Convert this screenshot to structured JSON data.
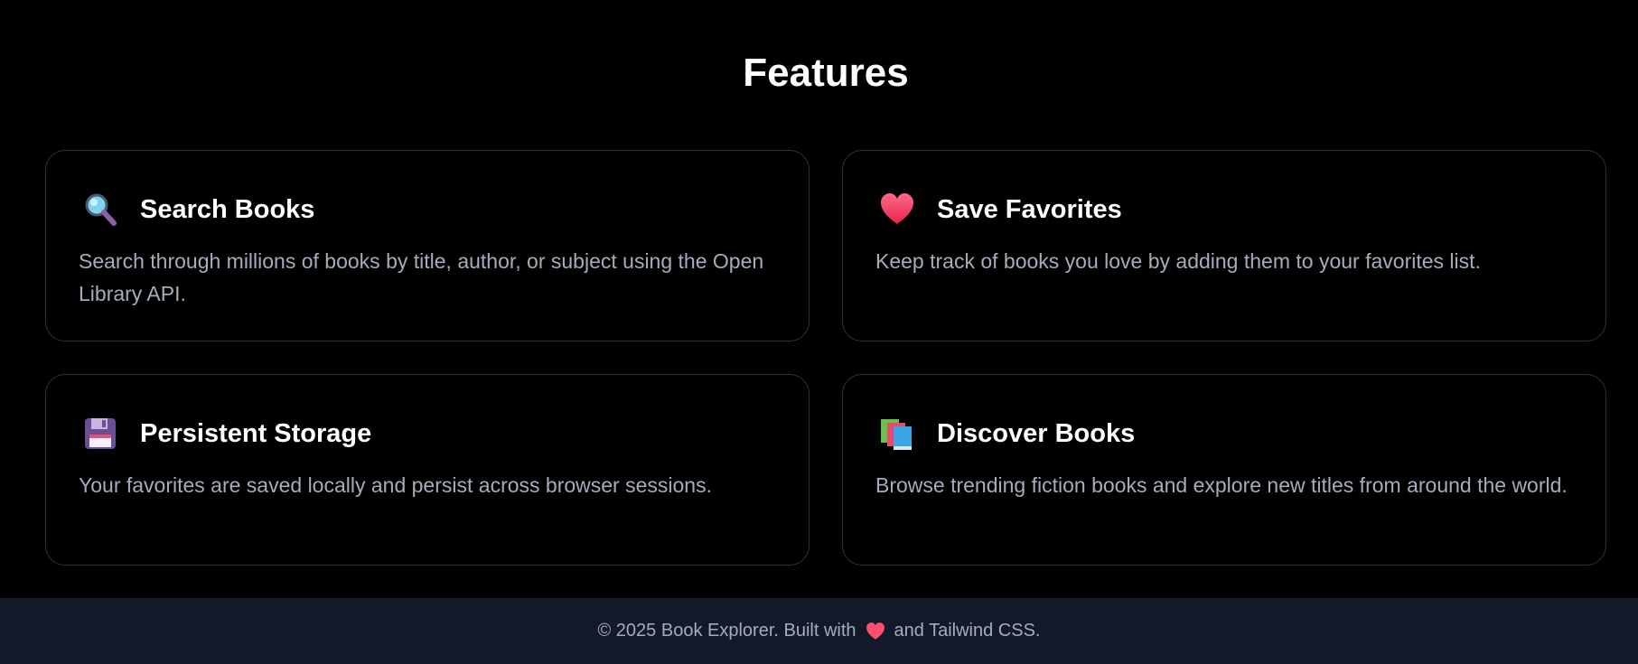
{
  "features": {
    "title": "Features",
    "cards": [
      {
        "icon": "magnifying-glass-icon",
        "title": "Search Books",
        "description": "Search through millions of books by title, author, or subject using the Open Library API."
      },
      {
        "icon": "heart-icon",
        "title": "Save Favorites",
        "description": "Keep track of books you love by adding them to your favorites list."
      },
      {
        "icon": "floppy-disk-icon",
        "title": "Persistent Storage",
        "description": "Your favorites are saved locally and persist across browser sessions."
      },
      {
        "icon": "books-icon",
        "title": "Discover Books",
        "description": "Browse trending fiction books and explore new titles from around the world."
      }
    ]
  },
  "footer": {
    "text_before": "© 2025 Book Explorer. Built with",
    "icon": "heart-icon",
    "text_after": "and Tailwind CSS."
  },
  "colors": {
    "background": "#000000",
    "card_border": "#2a3342",
    "title_text": "#ffffff",
    "body_text": "#a3adbb",
    "footer_background": "#121a2a",
    "heart": "#ff4f6e"
  }
}
